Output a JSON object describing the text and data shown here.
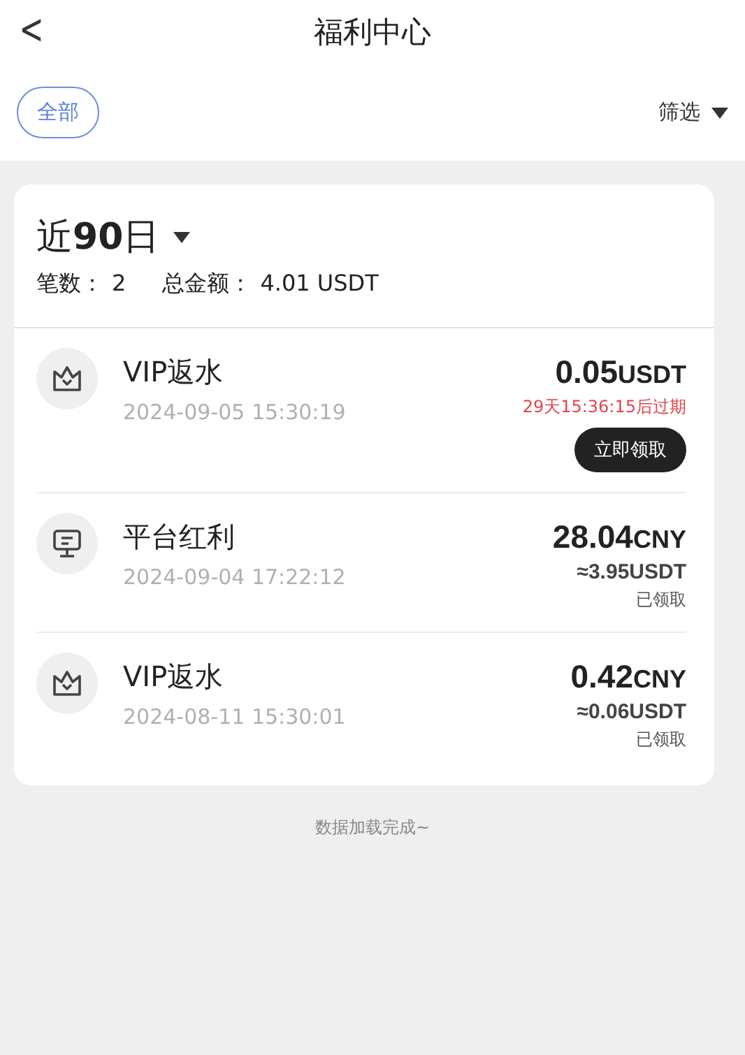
{
  "header": {
    "back": "<",
    "title": "福利中心"
  },
  "filter_bar": {
    "chip": {
      "label": "全部",
      "selected": true
    },
    "filter": "筛选"
  },
  "summary": {
    "period": "近**90**日",
    "count_label": "笔数：",
    "count": "2",
    "total_label": "总金额：",
    "total": "4.01 USDT"
  },
  "items": [
    {
      "kind": "crown",
      "title": "VIP返水",
      "time": "2024-09-05 15:30:19",
      "amount": "0.05",
      "currency": "USDT",
      "expiry": "29天15:36:15后过期",
      "button": "立即领取"
    },
    {
      "kind": "monitor",
      "title": "平台红利",
      "time": "2024-09-04 17:22:12",
      "amount": "28.04",
      "currency": "CNY",
      "approx": "≈3.95USDT",
      "status": "已领取"
    },
    {
      "kind": "crown",
      "title": "VIP返水",
      "time": "2024-08-11 15:30:01",
      "amount": "0.42",
      "currency": "CNY",
      "approx": "≈0.06USDT",
      "status": "已领取"
    }
  ],
  "footer": "数据加载完成~"
}
